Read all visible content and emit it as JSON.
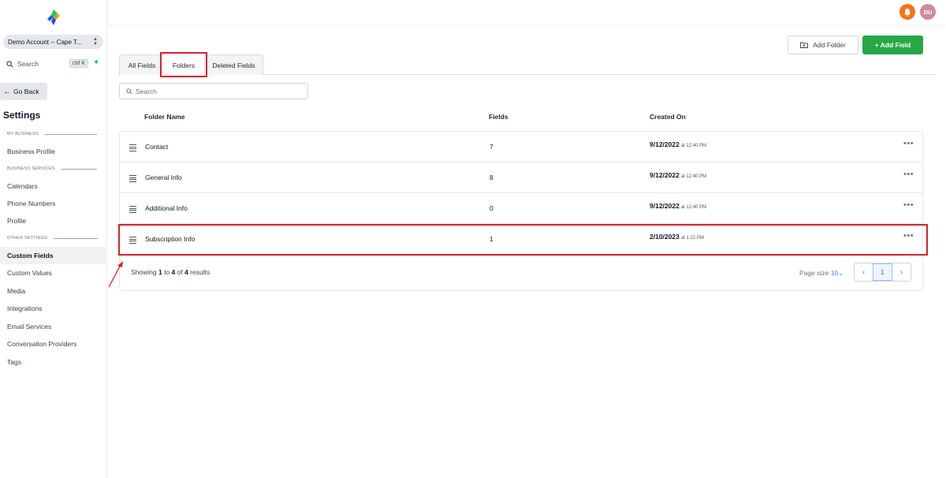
{
  "sidebar": {
    "account": "Demo Account -- Cape T...",
    "search": {
      "label": "Search",
      "shortcut": "ctrl K"
    },
    "go_back": "Go Back",
    "title": "Settings",
    "sections": {
      "my_business": "MY BUSINESS",
      "business_services": "BUSINESS SERVICES",
      "other_settings": "OTHER SETTINGS"
    },
    "items": [
      {
        "label": "Business Profile"
      },
      {
        "label": "Calendars"
      },
      {
        "label": "Phone Numbers"
      },
      {
        "label": "Profile"
      },
      {
        "label": "Custom Fields",
        "active": true
      },
      {
        "label": "Custom Values"
      },
      {
        "label": "Media"
      },
      {
        "label": "Integrations"
      },
      {
        "label": "Email Services"
      },
      {
        "label": "Conversation Providers"
      },
      {
        "label": "Tags"
      }
    ]
  },
  "header": {
    "avatar_initials": "DU",
    "bell_color": "#f97316"
  },
  "toolbar": {
    "add_folder": "Add Folder",
    "add_field": "+ Add Field",
    "accent": "#28a745"
  },
  "tabs": [
    {
      "label": "All Fields"
    },
    {
      "label": "Folders",
      "active": true
    },
    {
      "label": "Deleted Fields"
    }
  ],
  "table": {
    "search_placeholder": "Search",
    "columns": [
      "Folder Name",
      "Fields",
      "Created On"
    ],
    "rows": [
      {
        "name": "Contact",
        "fields": "7",
        "date": "9/12/2022",
        "time": "at 12:40 PM"
      },
      {
        "name": "General Info",
        "fields": "8",
        "date": "9/12/2022",
        "time": "at 12:40 PM"
      },
      {
        "name": "Additional Info",
        "fields": "0",
        "date": "9/12/2022",
        "time": "at 12:40 PM"
      },
      {
        "name": "Subscription Info",
        "fields": "1",
        "date": "2/10/2023",
        "time": "at 1:22 PM"
      }
    ],
    "more_label": "•••"
  },
  "footer": {
    "showing_prefix": "Showing ",
    "from": "1",
    "to_word": " to ",
    "to": "4",
    "of_word": " of ",
    "total": "4",
    "suffix": " results",
    "page_size_label": "Page size ",
    "page_size_value": "10",
    "current_page": "1"
  },
  "annotation_color": "#d9212c"
}
